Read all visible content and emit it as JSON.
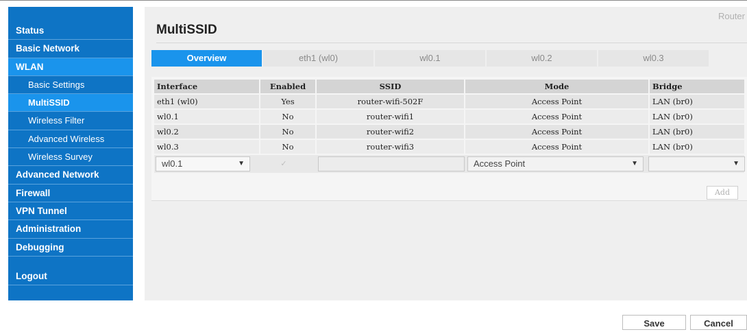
{
  "sidebar": {
    "items": [
      {
        "label": "Status"
      },
      {
        "label": "Basic Network"
      },
      {
        "label": "WLAN"
      },
      {
        "label": "Basic Settings"
      },
      {
        "label": "MultiSSID"
      },
      {
        "label": "Wireless Filter"
      },
      {
        "label": "Advanced Wireless"
      },
      {
        "label": "Wireless Survey"
      },
      {
        "label": "Advanced Network"
      },
      {
        "label": "Firewall"
      },
      {
        "label": "VPN Tunnel"
      },
      {
        "label": "Administration"
      },
      {
        "label": "Debugging"
      },
      {
        "label": "Logout"
      }
    ]
  },
  "header": {
    "brand": "Router",
    "title": "MultiSSID"
  },
  "tabs": [
    {
      "label": "Overview",
      "active": true
    },
    {
      "label": "eth1 (wl0)",
      "active": false
    },
    {
      "label": "wl0.1",
      "active": false
    },
    {
      "label": "wl0.2",
      "active": false
    },
    {
      "label": "wl0.3",
      "active": false
    }
  ],
  "table": {
    "headers": [
      "Interface",
      "Enabled",
      "SSID",
      "Mode",
      "Bridge"
    ],
    "rows": [
      [
        "eth1 (wl0)",
        "Yes",
        "router-wifi-502F",
        "Access Point",
        "LAN (br0)"
      ],
      [
        "wl0.1",
        "No",
        "router-wifi1",
        "Access Point",
        "LAN (br0)"
      ],
      [
        "wl0.2",
        "No",
        "router-wifi2",
        "Access Point",
        "LAN (br0)"
      ],
      [
        "wl0.3",
        "No",
        "router-wifi3",
        "Access Point",
        "LAN (br0)"
      ]
    ]
  },
  "edit_row": {
    "interface_value": "wl0.1",
    "enabled_checked": true,
    "ssid_value": "",
    "mode_value": "Access Point",
    "bridge_value": "",
    "add_label": "Add"
  },
  "footer": {
    "save_label": "Save",
    "cancel_label": "Cancel"
  },
  "colors": {
    "sidebar_bg": "#0e74c5",
    "accent": "#1a94ec",
    "panel_bg": "#efefef"
  }
}
